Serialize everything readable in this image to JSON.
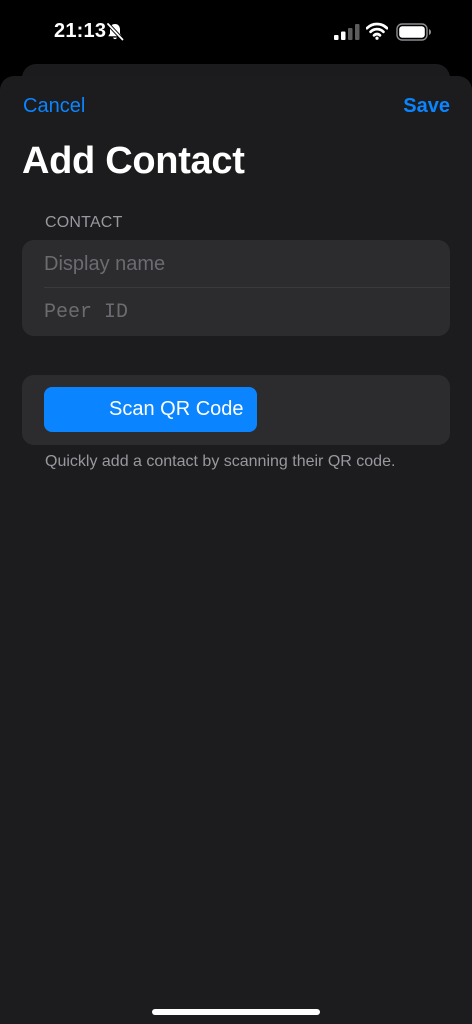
{
  "status_bar": {
    "time": "21:13",
    "bell_icon": "bell-slash-icon",
    "signal_icon": "cellular-signal-icon",
    "wifi_icon": "wifi-icon",
    "battery_icon": "battery-icon"
  },
  "nav": {
    "cancel_label": "Cancel",
    "save_label": "Save",
    "title": "Add Contact"
  },
  "contact_section": {
    "header": "CONTACT",
    "display_name": {
      "value": "",
      "placeholder": "Display name"
    },
    "peer_id": {
      "value": "",
      "placeholder": "Peer ID"
    }
  },
  "scan_section": {
    "button_label": "Scan QR Code",
    "footer": "Quickly add a contact by scanning their QR code."
  },
  "colors": {
    "accent": "#0a84ff",
    "sheet_background": "#1c1c1e",
    "group_background": "#2c2c2e",
    "secondary_text": "#98989e"
  }
}
